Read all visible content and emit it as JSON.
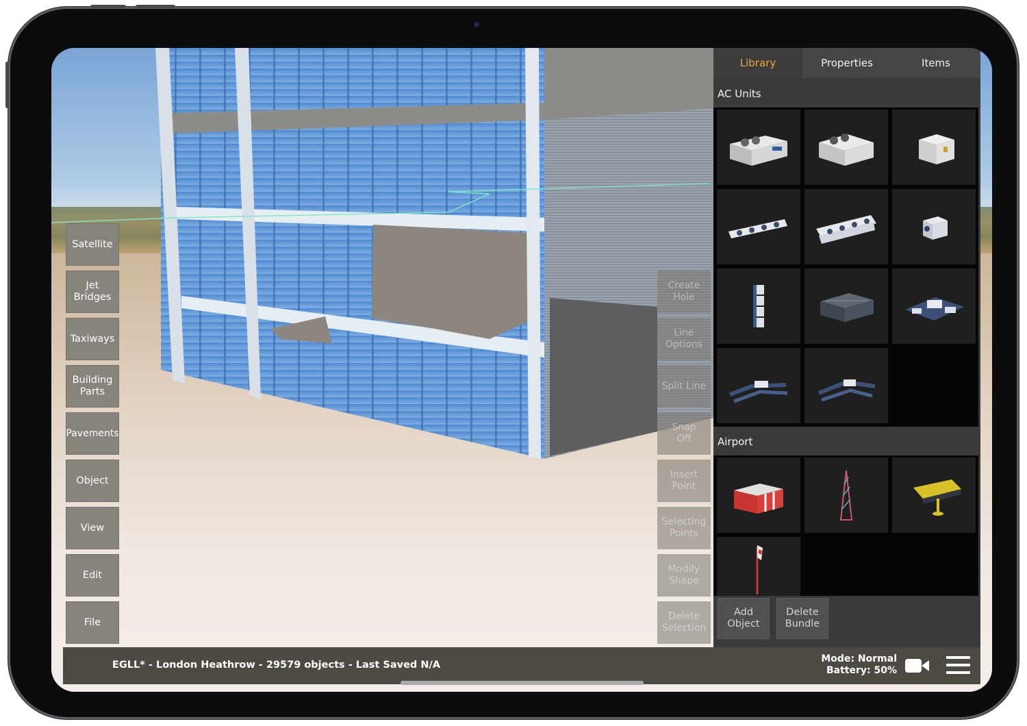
{
  "tabs": [
    {
      "label": "Library",
      "active": true
    },
    {
      "label": "Properties",
      "active": false
    },
    {
      "label": "Items",
      "active": false
    }
  ],
  "sections": {
    "ac_units": {
      "title": "AC Units",
      "items": [
        "ac-unit-large-twin-fan",
        "ac-unit-twin-fan",
        "ac-unit-compact",
        "ac-unit-row-of-four",
        "ac-unit-cluster-of-eight",
        "ac-unit-small-split",
        "ac-unit-vertical-stack",
        "ac-unit-rooftop-grille",
        "ac-unit-plant-assembly",
        "ac-unit-duct-assembly",
        "ac-unit-duct-frame"
      ]
    },
    "airport": {
      "title": "Airport",
      "items": [
        "airport-red-shelter",
        "airport-lattice-mast",
        "airport-sign-board",
        "airport-windsock"
      ]
    }
  },
  "sidebar": [
    {
      "label": "Satellite"
    },
    {
      "label": "Jet\nBridges"
    },
    {
      "label": "Taxiways"
    },
    {
      "label": "Building\nParts"
    },
    {
      "label": "Pavements"
    },
    {
      "label": "Object"
    },
    {
      "label": "View"
    },
    {
      "label": "Edit"
    },
    {
      "label": "File"
    }
  ],
  "tools": [
    {
      "label": "Create\nHole"
    },
    {
      "label": "Line\nOptions"
    },
    {
      "label": "Split Line"
    },
    {
      "label": "Snap\nOff"
    },
    {
      "label": "Insert\nPoint"
    },
    {
      "label": "Selecting\nPoints"
    },
    {
      "label": "Modify\nShape"
    },
    {
      "label": "Delete\nSelection"
    }
  ],
  "panel_buttons": {
    "add_object": "Add\nObject",
    "delete_bundle": "Delete\nBundle"
  },
  "status": {
    "text": "EGLL* - London Heathrow - 29579 objects - Last Saved N/A",
    "mode": "Mode: Normal",
    "battery": "Battery: 50%"
  },
  "colors": {
    "active_tab": "#f0a540",
    "panel_bg": "#3a3a3a",
    "status_bg": "#4d4943"
  }
}
